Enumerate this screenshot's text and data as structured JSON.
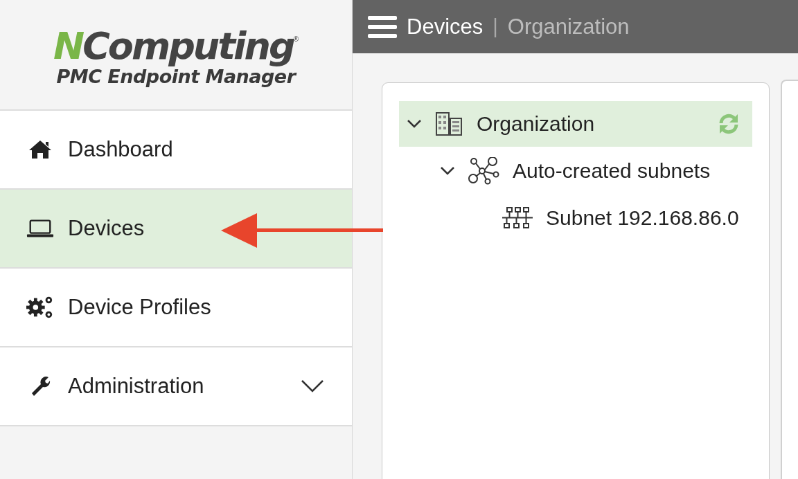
{
  "logo": {
    "brand": "NComputing",
    "registered": "®",
    "product": "PMC Endpoint Manager"
  },
  "sidebar": {
    "items": [
      {
        "label": "Dashboard",
        "kind": "link",
        "selected": false
      },
      {
        "label": "Devices",
        "kind": "link",
        "selected": true
      },
      {
        "label": "Device Profiles",
        "kind": "link",
        "selected": false
      },
      {
        "label": "Administration",
        "kind": "group",
        "selected": false,
        "expanded": false
      }
    ]
  },
  "header": {
    "title": "Devices",
    "separator": "|",
    "breadcrumb": "Organization"
  },
  "tree": [
    {
      "label": "Organization",
      "kind": "organization",
      "selected": true,
      "expanded": true,
      "children": [
        {
          "label": "Auto-created subnets",
          "kind": "group",
          "selected": false,
          "expanded": true,
          "children": [
            {
              "label": "Subnet 192.168.86.0",
              "kind": "subnet",
              "selected": false
            }
          ]
        }
      ]
    }
  ]
}
